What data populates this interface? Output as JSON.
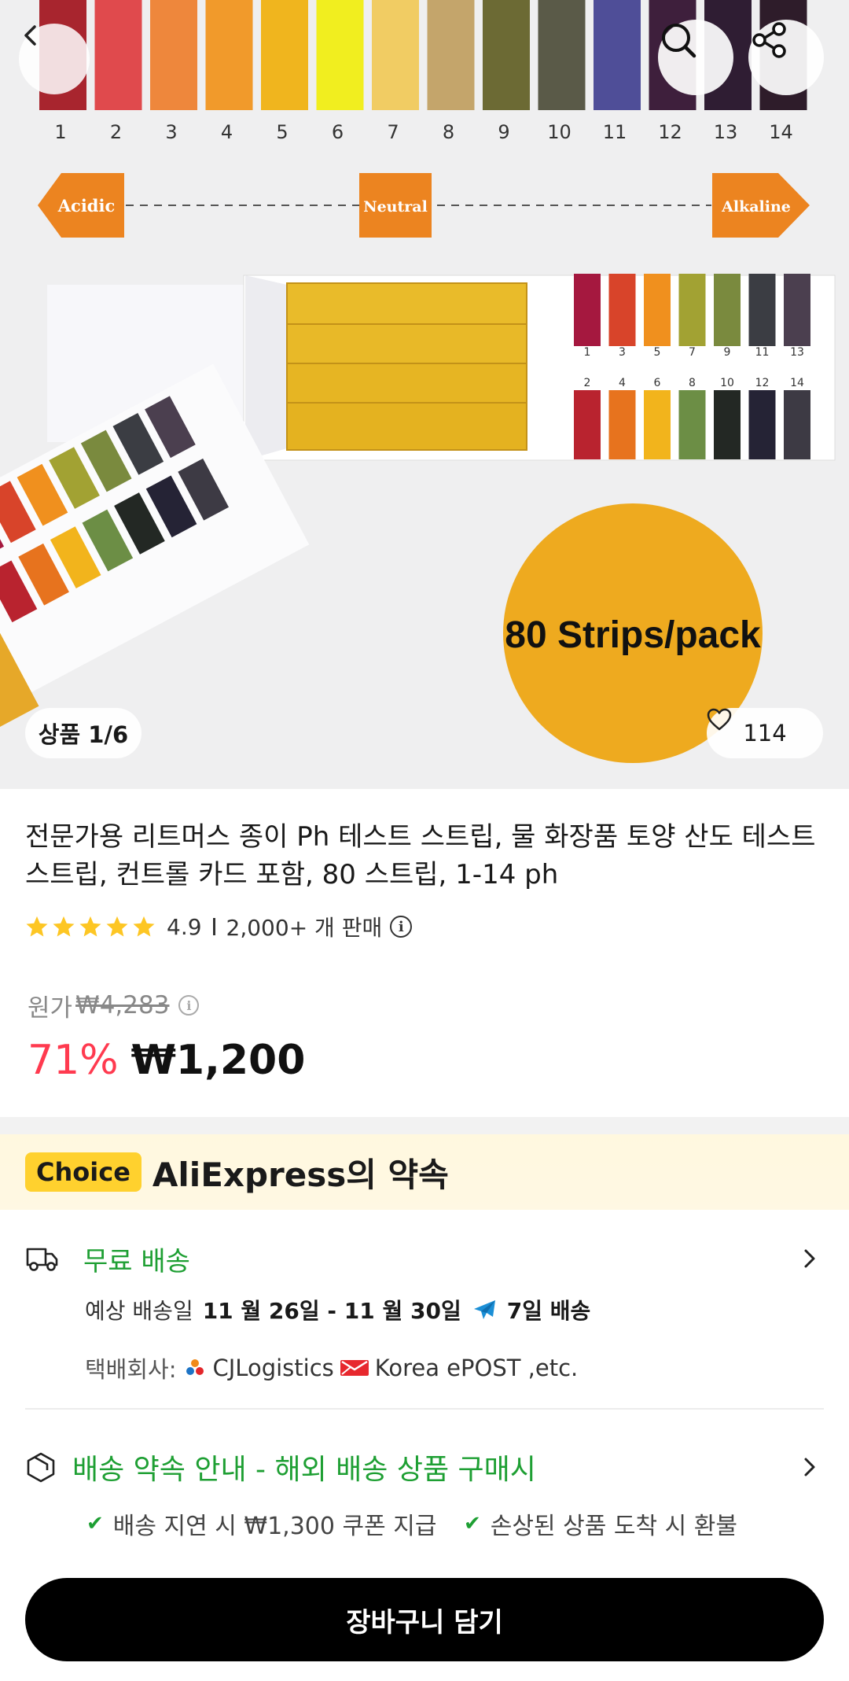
{
  "hero": {
    "ph_numbers": [
      "1",
      "2",
      "3",
      "4",
      "5",
      "6",
      "7",
      "8",
      "9",
      "10",
      "11",
      "12",
      "13",
      "14"
    ],
    "ph_colors": [
      "#a8252e",
      "#e04a4d",
      "#ee873c",
      "#f19a2b",
      "#f0b51e",
      "#f1ee1f",
      "#f1cc63",
      "#c4a56b",
      "#6c6a34",
      "#5a5a48",
      "#4f4e98",
      "#3e1f3c",
      "#2f1d33",
      "#2e1c2a"
    ],
    "acidic_label": "Acidic",
    "neutral_label": "Neutral",
    "alkaline_label": "Alkaline",
    "card_odd_numbers": [
      "1",
      "3",
      "5",
      "7",
      "9",
      "11",
      "13"
    ],
    "card_even_numbers": [
      "2",
      "4",
      "6",
      "8",
      "10",
      "12",
      "14"
    ],
    "card_top_colors": [
      "#a5183f",
      "#d8442a",
      "#f0901e",
      "#a2a233",
      "#7a8a3e",
      "#3b3d43",
      "#4b3f4f"
    ],
    "card_bottom_colors": [
      "#b9232f",
      "#e7731e",
      "#f2b41c",
      "#6c8e45",
      "#232824",
      "#252335",
      "#3d3a44"
    ],
    "badge_text": "80 Strips/pack"
  },
  "image_counter": "상품 1/6",
  "likes": "114",
  "title": "전문가용 리트머스 종이 Ph 테스트 스트립, 물 화장품 토양 산도 테스트 스트립, 컨트롤 카드 포함, 80 스트립, 1-14 ph",
  "rating": {
    "score": "4.9",
    "sold": "2,000+ 개 판매"
  },
  "price": {
    "original_label": "원가",
    "original_value": "₩4,283",
    "discount": "71%",
    "current": "₩1,200"
  },
  "choice": {
    "badge": "Choice",
    "text": "AliExpress의 약속"
  },
  "shipping": {
    "title": "무료 배송",
    "eta_label": "예상 배송일",
    "eta_dates": "11 월 26일 - 11 월 30일",
    "eta_days": "7일 배송",
    "carrier_label": "택배회사:",
    "carrier_1": "CJLogistics",
    "carrier_2": "Korea ePOST ,etc."
  },
  "promise": {
    "title": "배송 약속 안내 - 해외 배송 상품 구매시",
    "items": [
      "배송 지연 시 ₩1,300 쿠폰 지급",
      "손상된 상품 도착 시 환불"
    ]
  },
  "cta": {
    "add_to_cart": "장바구니 담기"
  },
  "colors": {
    "accent_green": "#1e9f33",
    "discount_red": "#ff3a4f",
    "choice_yellow": "#ffd12e"
  }
}
